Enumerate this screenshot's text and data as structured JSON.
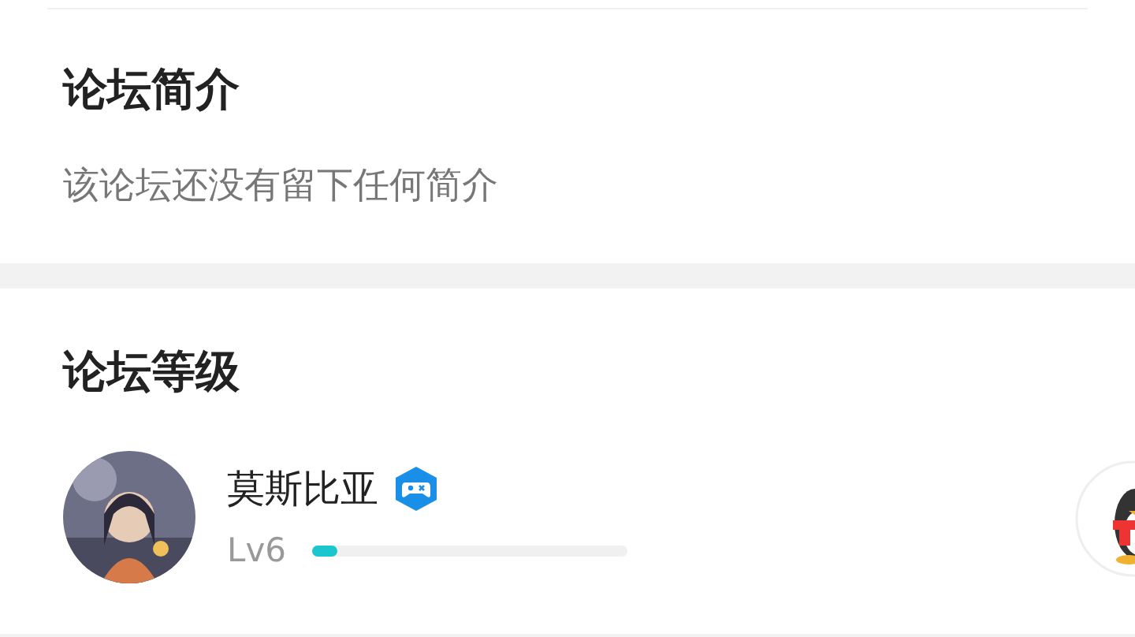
{
  "intro": {
    "title": "论坛简介",
    "text": "该论坛还没有留下任何简介"
  },
  "level_section": {
    "title": "论坛等级",
    "user": {
      "name": "莫斯比亚",
      "level_label": "Lv6",
      "level": 0.08
    }
  }
}
